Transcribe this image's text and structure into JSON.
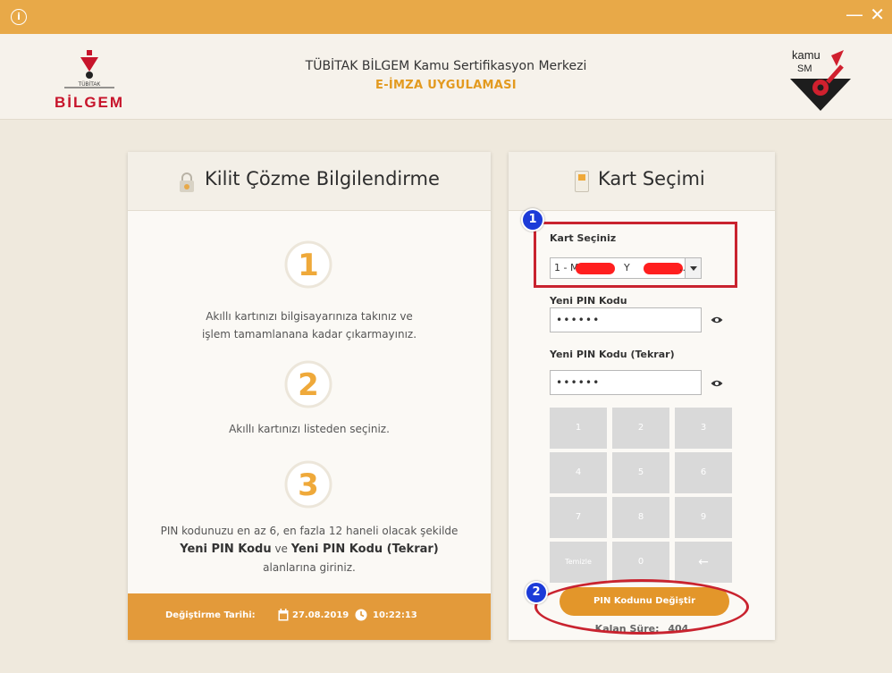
{
  "window": {
    "info_glyph": "i",
    "minimize_glyph": "—",
    "close_glyph": "✕"
  },
  "header": {
    "left_logo_text_top": "TÜBİTAK",
    "left_logo_text": "BİLGEM",
    "title": "TÜBİTAK BİLGEM Kamu Sertifikasyon Merkezi",
    "subtitle": "E-İMZA UYGULAMASI",
    "right_logo_text1": "kamu",
    "right_logo_text2": "SM"
  },
  "left_panel": {
    "title": "Kilit Çözme Bilgilendirme",
    "steps": [
      {
        "number": "1",
        "line1": "Akıllı kartınızı bilgisayarınıza takınız ve",
        "line2": "işlem tamamlanana kadar çıkarmayınız."
      },
      {
        "number": "2",
        "line1": "Akıllı kartınızı listeden seçiniz."
      },
      {
        "number": "3",
        "line1": "PIN kodunuzu en az 6, en fazla 12 haneli olacak şekilde",
        "bold_a": "Yeni PIN Kodu",
        "connector": " ve ",
        "bold_b": "Yeni PIN Kodu (Tekrar)",
        "line3": "alanlarına giriniz."
      }
    ],
    "footer": {
      "date_label": "Değiştirme Tarihi:",
      "date": "27.08.2019",
      "time": "10:22:13"
    }
  },
  "right_panel": {
    "title": "Kart Seçimi",
    "card_select_label": "Kart Seçiniz",
    "card_select_value": "1 - M",
    "card_select_mid": "Y",
    "card_select_tail": "..",
    "new_pin_label": "Yeni PIN Kodu",
    "new_pin_value": "••••••",
    "new_pin_repeat_label": "Yeni PIN Kodu (Tekrar)",
    "new_pin_repeat_value": "••••••",
    "keypad": [
      "1",
      "2",
      "3",
      "4",
      "5",
      "6",
      "7",
      "8",
      "9",
      "Temizle",
      "0",
      "←"
    ],
    "change_button": "PIN Kodunu Değiştir",
    "remaining_label": "Kalan Süre:",
    "remaining_value": "404"
  },
  "annotations": {
    "marker1": "1",
    "marker2": "2",
    "color": "#c9232f",
    "marker_color": "#1c3bd8"
  },
  "colors": {
    "titlebar": "#e8a948",
    "accent": "#e39a3a",
    "subtitle": "#e39a1f"
  }
}
